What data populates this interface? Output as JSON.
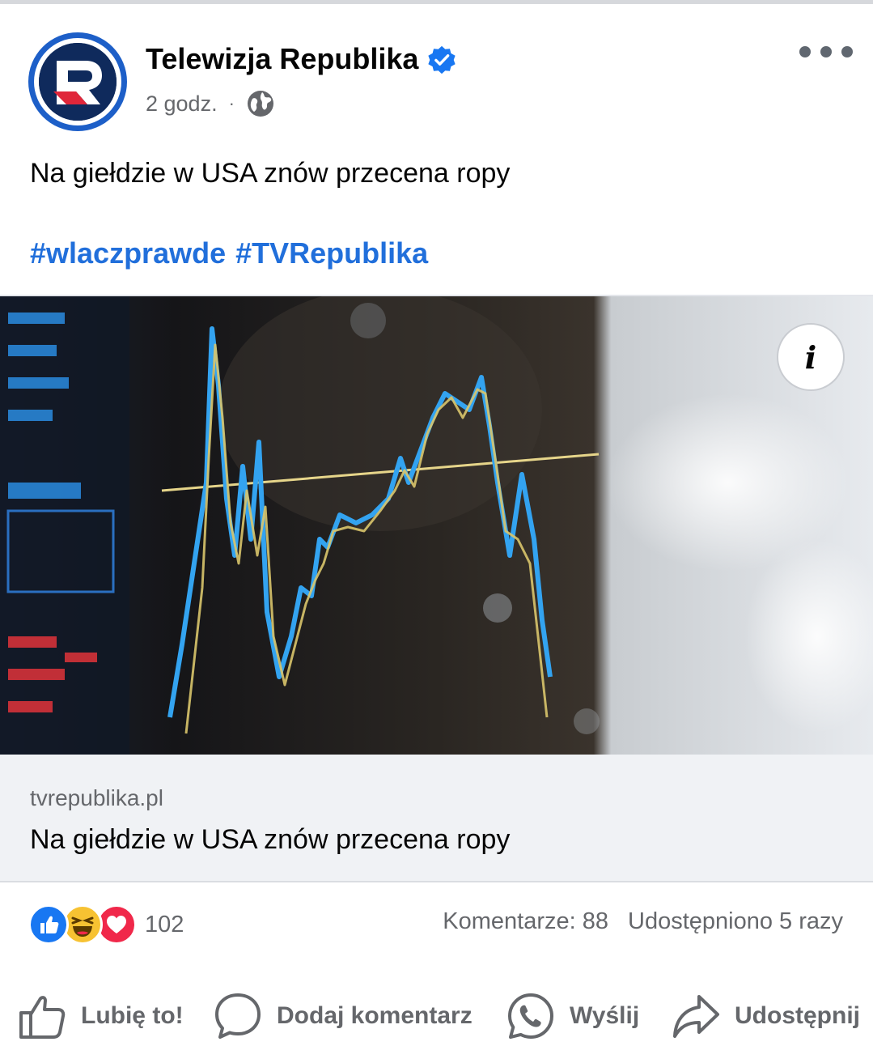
{
  "post": {
    "page_name": "Telewizja Republika",
    "verified_icon": "verified-badge-icon",
    "time": "2 godz.",
    "separator": "·",
    "audience_icon": "globe-icon",
    "text": "Na giełdzie w USA znów przecena ropy",
    "hashtags": [
      "#wlaczprawde",
      "#TVRepublika"
    ]
  },
  "link_preview": {
    "domain": "tvrepublika.pl",
    "title": "Na giełdzie w USA znów przecena ropy",
    "info_button_glyph": "i"
  },
  "stats": {
    "reactions": [
      "like",
      "haha",
      "love"
    ],
    "reaction_count": "102",
    "comments": "Komentarze: 88",
    "shares": "Udostępniono 5 razy"
  },
  "actions": {
    "like": "Lubię to!",
    "comment": "Dodaj komentarz",
    "send": "Wyślij",
    "share": "Udostępnij"
  },
  "colors": {
    "link_blue": "#216fdb",
    "verified_blue": "#1877f2",
    "secondary_text": "#65676b",
    "like_blue": "#1877f2",
    "love_red": "#f0284a",
    "haha_yellow": "#f7c232"
  }
}
